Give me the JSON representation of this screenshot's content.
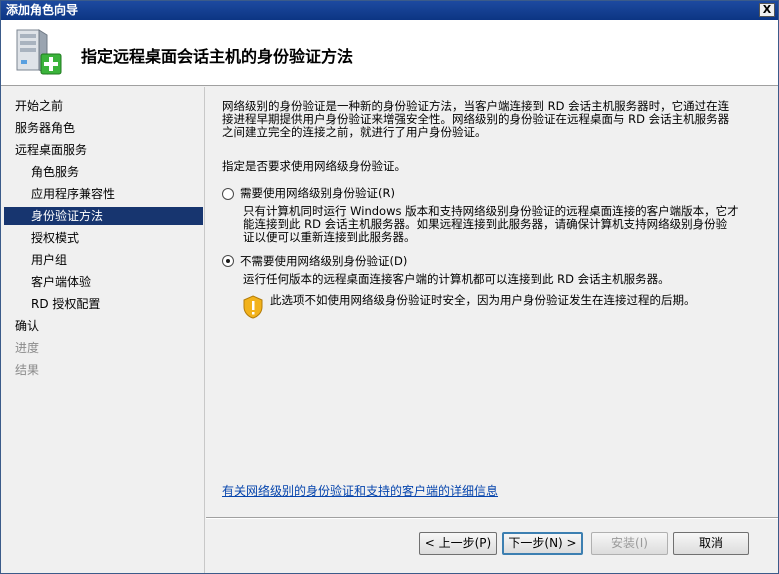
{
  "window": {
    "title": "添加角色向导",
    "close_label": "X"
  },
  "header": {
    "title": "指定远程桌面会话主机的身份验证方法",
    "icon": "server-add-icon"
  },
  "sidebar": {
    "items": [
      {
        "label": "开始之前",
        "state": "normal"
      },
      {
        "label": "服务器角色",
        "state": "normal"
      },
      {
        "label": "远程桌面服务",
        "state": "normal"
      },
      {
        "label": "角色服务",
        "state": "sub"
      },
      {
        "label": "应用程序兼容性",
        "state": "sub"
      },
      {
        "label": "身份验证方法",
        "state": "active"
      },
      {
        "label": "授权模式",
        "state": "sub"
      },
      {
        "label": "用户组",
        "state": "sub"
      },
      {
        "label": "客户端体验",
        "state": "sub"
      },
      {
        "label": "RD 授权配置",
        "state": "sub"
      },
      {
        "label": "确认",
        "state": "normal"
      },
      {
        "label": "进度",
        "state": "disabled"
      },
      {
        "label": "结果",
        "state": "disabled"
      }
    ]
  },
  "main": {
    "intro_line1": "网络级别的身份验证是一种新的身份验证方法，当客户端连接到 RD 会话主机服务器时，它通过在连",
    "intro_line2": "接进程早期提供用户身份验证来增强安全性。网络级别的身份验证在远程桌面与 RD 会话主机服务器",
    "intro_line3": "之间建立完全的连接之前，就进行了用户身份验证。",
    "question": "指定是否要求使用网络级身份验证。",
    "option1": {
      "label": "需要使用网络级别身份验证(R)",
      "desc_line1": "只有计算机同时运行 Windows 版本和支持网络级别身份验证的远程桌面连接的客户端版本，它才",
      "desc_line2": "能连接到此 RD 会话主机服务器。如果远程连接到此服务器，请确保计算机支持网络级别身份验",
      "desc_line3": "证以便可以重新连接到此服务器。",
      "checked": false
    },
    "option2": {
      "label": "不需要使用网络级别身份验证(D)",
      "desc": "运行任何版本的远程桌面连接客户端的计算机都可以连接到此 RD 会话主机服务器。",
      "checked": true
    },
    "warning": "此选项不如使用网络级身份验证时安全，因为用户身份验证发生在连接过程的后期。",
    "link": "有关网络级别的身份验证和支持的客户端的详细信息"
  },
  "footer": {
    "prev": "< 上一步(P)",
    "next": "下一步(N) >",
    "install": "安装(I)",
    "cancel": "取消"
  }
}
